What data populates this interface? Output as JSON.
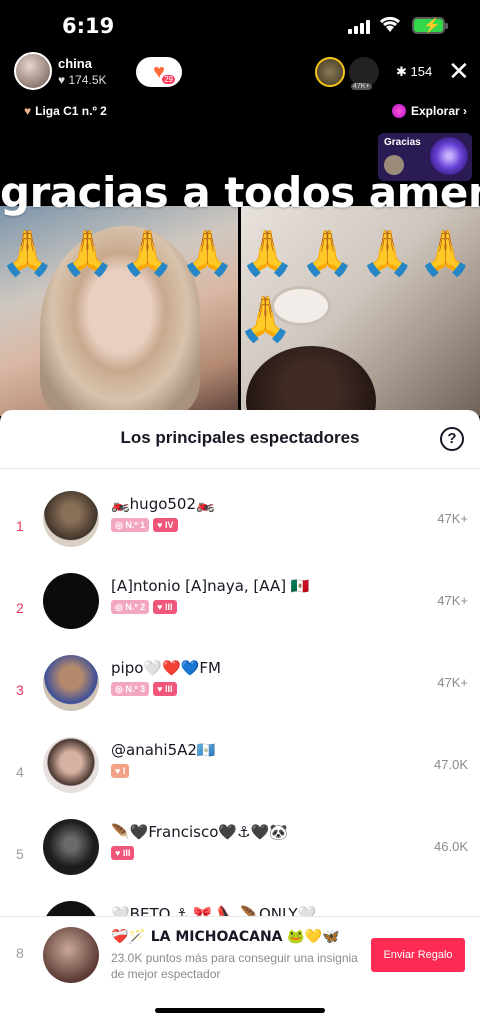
{
  "status_bar": {
    "time": "6:19"
  },
  "live_header": {
    "host_name": "china",
    "host_likes": "♥ 174.5K",
    "gift_count": "29",
    "top_viewer_badge": "47K+",
    "viewer_count": "✱ 154",
    "league": "Liga C1 n.º 2",
    "explore": "Explorar ›",
    "gracias_card_label": "Gracias"
  },
  "video": {
    "overlay_text": "gracias a todos amen",
    "emoji": "🙏"
  },
  "sheet": {
    "title": "Los principales espectadores",
    "help": "?",
    "rows": [
      {
        "rank": "1",
        "name": "🏍️hugo502🏍️",
        "badges": [
          "◎ N.º 1",
          "♥ IV"
        ],
        "score": "47K+"
      },
      {
        "rank": "2",
        "name": "[A]ntonio  [A]naya,  [AA] 🇲🇽",
        "badges": [
          "◎ N.º 2",
          "♥ III"
        ],
        "score": "47K+"
      },
      {
        "rank": "3",
        "name": "pipo🤍❤️💙FM",
        "badges": [
          "◎ N.º 3",
          "♥ III"
        ],
        "score": "47K+"
      },
      {
        "rank": "4",
        "name": "@anahi5A2🇬🇹",
        "badges": [
          "♥ I"
        ],
        "score": "47.0K"
      },
      {
        "rank": "5",
        "name": "🪶🖤Francisco🖤⚓🖤🐼",
        "badges": [
          "♥ III"
        ],
        "score": "46.0K"
      },
      {
        "rank": "6",
        "name": "🤍BETO ⚓ 🎀 👠 🪶ONLY🤍",
        "badges": [],
        "score": ""
      }
    ]
  },
  "footer": {
    "rank": "8",
    "name": "❤️‍🩹🪄 LA MICHOACANA 🐸💛🦋",
    "hint": "23.0K puntos más para conseguir una insignia de mejor espectador",
    "button": "Enviar Regalo"
  },
  "colors": {
    "accent": "#fe2c55",
    "rank_top": "#e8345f"
  }
}
